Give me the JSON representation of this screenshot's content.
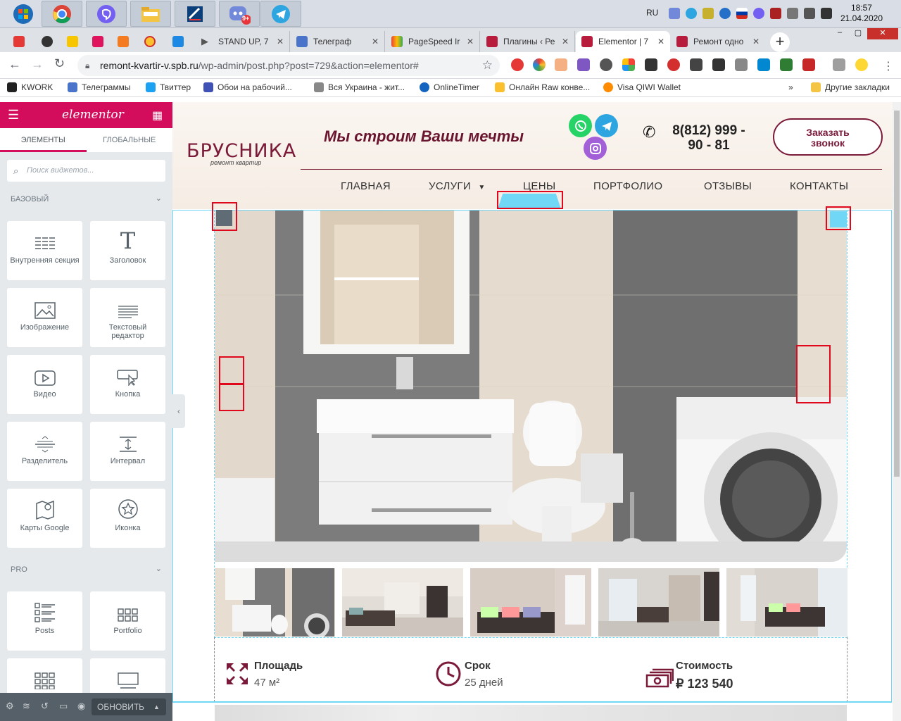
{
  "taskbar": {
    "lang": "RU",
    "time": "18:57",
    "date": "21.04.2020",
    "apps": [
      "windows-start",
      "chrome",
      "viber",
      "explorer",
      "editor",
      "discord",
      "telegram"
    ],
    "discord_badge": "9+"
  },
  "tabs": [
    {
      "label": "STAND UP, 7",
      "icon": "play-icon"
    },
    {
      "label": "Телеграф",
      "icon": "telegraph-icon"
    },
    {
      "label": "PageSpeed Ir",
      "icon": "pagespeed-icon"
    },
    {
      "label": "Плагины ‹ Ре",
      "icon": "site-icon"
    },
    {
      "label": "Elementor | 7",
      "icon": "site-icon",
      "active": true
    },
    {
      "label": "Ремонт одно",
      "icon": "site-icon"
    }
  ],
  "address": {
    "host": "remont-kvartir-v.spb.ru",
    "path": "/wp-admin/post.php?post=729&action=elementor#"
  },
  "bookmarks": [
    "KWORK",
    "Телеграммы",
    "Твиттер",
    "Обои на рабочий...",
    "Вся Украина - жит...",
    "OnlineTimer",
    "Онлайн Raw конве...",
    "Visa QIWI Wallet"
  ],
  "bookmarks_more": "»",
  "bookmarks_other": "Другие закладки",
  "panel": {
    "logo": "elementor",
    "tab_elements": "ЭЛЕМЕНТЫ",
    "tab_global": "ГЛОБАЛЬНЫЕ",
    "search_placeholder": "Поиск виджетов...",
    "cat_basic": "БАЗОВЫЙ",
    "cat_pro": "PRO",
    "widgets": [
      "Внутренняя секция",
      "Заголовок",
      "Изображение",
      "Текстовый редактор",
      "Видео",
      "Кнопка",
      "Разделитель",
      "Интервал",
      "Карты Google",
      "Иконка"
    ],
    "pro_widgets": [
      "Posts",
      "Portfolio"
    ],
    "update_label": "ОБНОВИТЬ"
  },
  "site": {
    "logo_main": "БРУСНИКА",
    "logo_sub": "ремонт квартир",
    "slogan": "Мы строим Ваши мечты",
    "phone_line1": "8(812) 999 -",
    "phone_line2": "90 - 81",
    "call_line1": "Заказать",
    "call_line2": "звонок",
    "nav": [
      "ГЛАВНАЯ",
      "УСЛУГИ",
      "ЦЕНЫ",
      "ПОРТФОЛИО",
      "ОТЗЫВЫ",
      "КОНТАКТЫ"
    ],
    "stats": [
      {
        "title": "Площадь",
        "value": "47 м²"
      },
      {
        "title": "Срок",
        "value": "25 дней"
      },
      {
        "title": "Стоимость",
        "value": "₽ 123 540"
      }
    ]
  },
  "colors": {
    "accent": "#d30c5c",
    "brand": "#7a1a38",
    "selection": "#71d7f7"
  }
}
